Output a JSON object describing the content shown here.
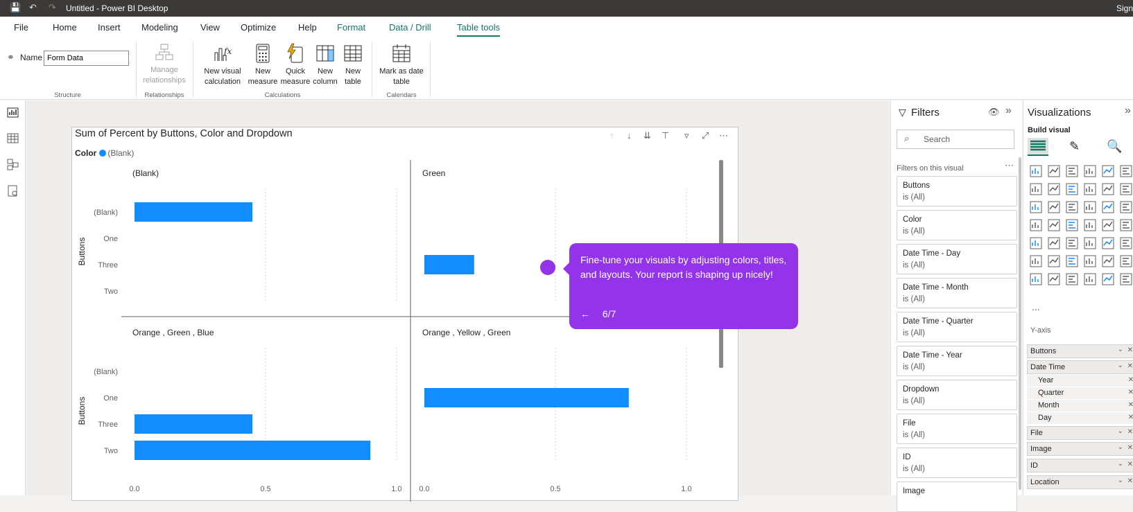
{
  "titlebar": {
    "title": "Untitled - Power BI Desktop",
    "sign": "Sign"
  },
  "menu": {
    "tabs": [
      "File",
      "Home",
      "Insert",
      "Modeling",
      "View",
      "Optimize",
      "Help",
      "Format",
      "Data / Drill",
      "Table tools"
    ]
  },
  "ribbon": {
    "name_label": "Name",
    "name_value": "Form Data",
    "structure": "Structure",
    "relationships": "Relationships",
    "manage_relationships": "Manage relationships",
    "calculations": "Calculations",
    "calendars": "Calendars",
    "new_visual_calc": "New visual calculation",
    "new_measure": "New measure",
    "quick_measure": "Quick measure",
    "new_column": "New column",
    "new_table": "New table",
    "mark_date": "Mark as date table"
  },
  "visual": {
    "title": "Sum of Percent by Buttons, Color and Dropdown",
    "legend_title": "Color",
    "legend_item": "(Blank)"
  },
  "chart_data": {
    "type": "bar",
    "title": "Sum of Percent by Buttons, Color and Dropdown",
    "legend": "Color",
    "ylabel": "Buttons",
    "categories": [
      "(Blank)",
      "One",
      "Three",
      "Two"
    ],
    "xlim": [
      0,
      1
    ],
    "xticks": [
      "0.0",
      "0.5",
      "1.0"
    ],
    "color": "#118dff",
    "panels": [
      {
        "name": "(Blank)",
        "values": [
          0.45,
          0,
          0,
          0
        ]
      },
      {
        "name": "Green",
        "values": [
          0,
          0,
          0.19,
          0
        ]
      },
      {
        "name": "Orange , Green , Blue",
        "values": [
          0,
          0,
          0.45,
          0.9
        ]
      },
      {
        "name": "Orange , Yellow , Green",
        "values": [
          0,
          0.78,
          0,
          0
        ]
      }
    ]
  },
  "tooltip": {
    "message": "Fine-tune your visuals by adjusting colors, titles, and layouts. Your report is shaping up nicely!",
    "back": "←",
    "step": "6/7"
  },
  "filters": {
    "title": "Filters",
    "search": "Search",
    "section": "Filters on this visual",
    "items": [
      {
        "name": "Buttons",
        "value": "is (All)"
      },
      {
        "name": "Color",
        "value": "is (All)"
      },
      {
        "name": "Date Time - Day",
        "value": "is (All)"
      },
      {
        "name": "Date Time - Month",
        "value": "is (All)"
      },
      {
        "name": "Date Time - Quarter",
        "value": "is (All)"
      },
      {
        "name": "Date Time - Year",
        "value": "is (All)"
      },
      {
        "name": "Dropdown",
        "value": "is (All)"
      },
      {
        "name": "File",
        "value": "is (All)"
      },
      {
        "name": "ID",
        "value": "is (All)"
      },
      {
        "name": "Image",
        "value": ""
      }
    ]
  },
  "viz": {
    "title": "Visualizations",
    "build": "Build visual",
    "yaxis": "Y-axis",
    "more": "...",
    "fields": [
      "Buttons",
      "Date Time",
      "Year",
      "Quarter",
      "Month",
      "Day",
      "File",
      "Image",
      "ID",
      "Location"
    ]
  },
  "colors": {
    "accent": "#117865",
    "bar": "#118dff",
    "tooltip": "#9333ea"
  }
}
